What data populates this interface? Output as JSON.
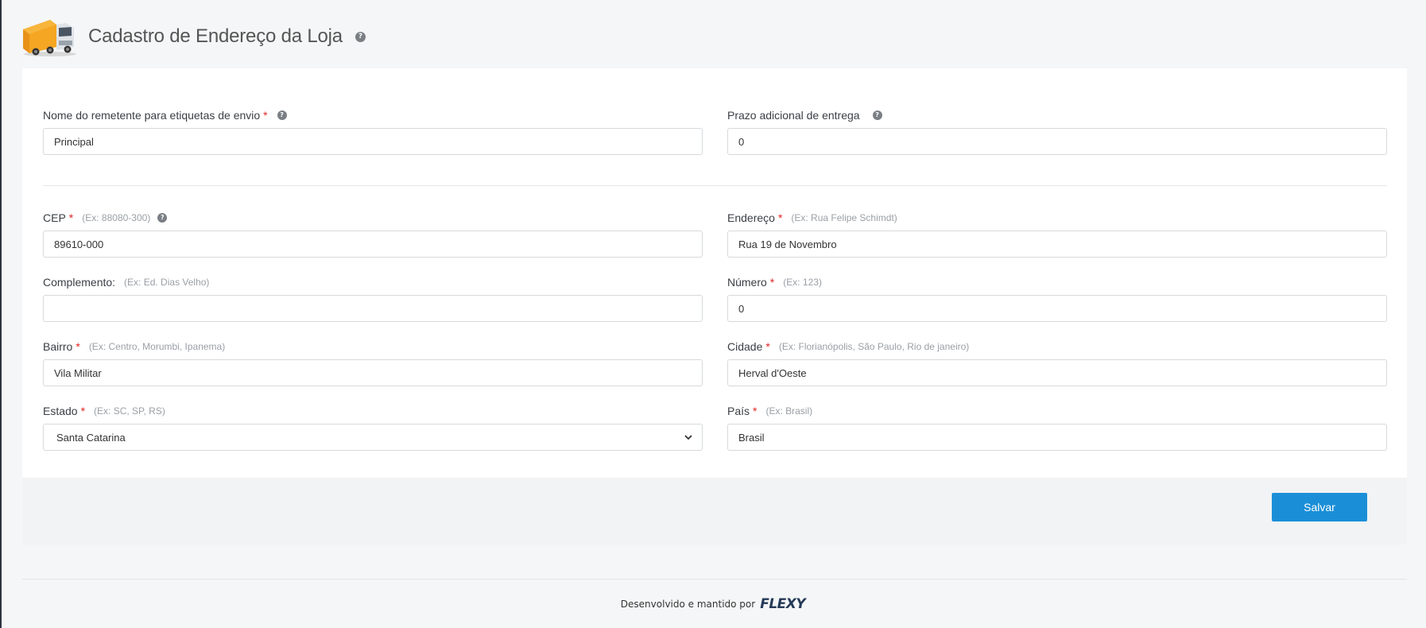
{
  "header": {
    "title": "Cadastro de Endereço da Loja",
    "help_glyph": "?",
    "truck_icon": "truck-icon"
  },
  "form": {
    "sender_name": {
      "label": "Nome do remetente para etiquetas de envio",
      "required": "*",
      "value": "Principal"
    },
    "extra_delivery_days": {
      "label": "Prazo adicional de entrega",
      "value": "0"
    },
    "cep": {
      "label": "CEP",
      "required": "*",
      "hint": "(Ex: 88080-300)",
      "value": "89610-000"
    },
    "address": {
      "label": "Endereço",
      "required": "*",
      "hint": "(Ex: Rua Felipe Schimdt)",
      "value": "Rua 19 de Novembro"
    },
    "complement": {
      "label": "Complemento:",
      "hint": "(Ex: Ed. Dias Velho)",
      "value": ""
    },
    "number": {
      "label": "Número",
      "required": "*",
      "hint": "(Ex: 123)",
      "value": "0"
    },
    "neighborhood": {
      "label": "Bairro",
      "required": "*",
      "hint": "(Ex: Centro, Morumbi, Ipanema)",
      "value": "Vila Militar"
    },
    "city": {
      "label": "Cidade",
      "required": "*",
      "hint": "(Ex: Florianópolis, São Paulo, Rio de janeiro)",
      "value": "Herval d'Oeste"
    },
    "state": {
      "label": "Estado",
      "required": "*",
      "hint": "(Ex: SC, SP, RS)",
      "selected": "Santa Catarina"
    },
    "country": {
      "label": "País",
      "required": "*",
      "hint": "(Ex: Brasil)",
      "value": "Brasil"
    }
  },
  "actions": {
    "save_label": "Salvar"
  },
  "footer": {
    "text": "Desenvolvido e mantido por",
    "brand": "FLEXY"
  },
  "colors": {
    "primary": "#1a8fd8",
    "required": "#e02424",
    "background": "#f5f6f7",
    "truck_cargo": "#f5a623"
  }
}
